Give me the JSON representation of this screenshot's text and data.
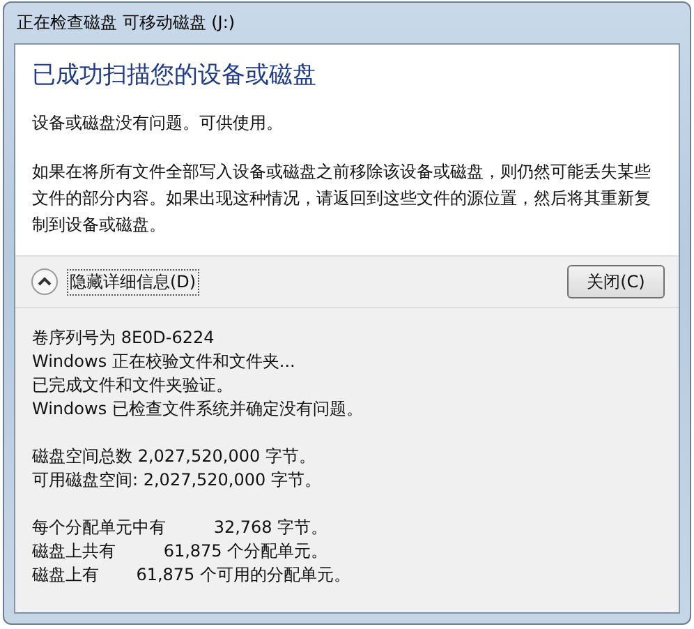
{
  "window": {
    "title": "正在检查磁盘 可移动磁盘 (J:)"
  },
  "heading": "已成功扫描您的设备或磁盘",
  "paragraphs": [
    "设备或磁盘没有问题。可供使用。",
    "如果在将所有文件全部写入设备或磁盘之前移除该设备或磁盘，则仍然可能丢失某些文件的部分内容。如果出现这种情况，请返回到这些文件的源位置，然后将其重新复制到设备或磁盘。"
  ],
  "details_toggle": {
    "label": "隐藏详细信息(D)",
    "expanded": true
  },
  "close_button": "关闭(C)",
  "details": [
    [
      "卷序列号为 8E0D-6224",
      "Windows 正在校验文件和文件夹...",
      "已完成文件和文件夹验证。",
      "Windows 已检查文件系统并确定没有问题。"
    ],
    [
      "磁盘空间总数 2,027,520,000 字节。",
      "可用磁盘空间: 2,027,520,000 字节。"
    ],
    [
      "每个分配单元中有         32,768 字节。",
      "磁盘上共有         61,875 个分配单元。",
      "磁盘上有       61,875 个可用的分配单元。"
    ]
  ]
}
